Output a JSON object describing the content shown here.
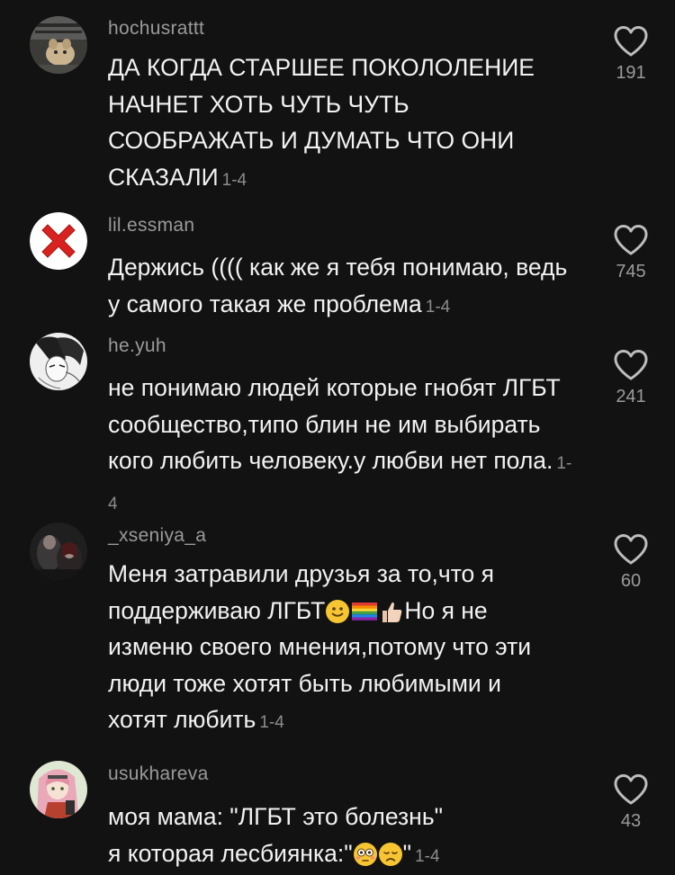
{
  "comments": [
    {
      "username": "hochusrattt",
      "text": "ДА КОГДА СТАРШЕЕ ПОКОЛОЛЕНИЕ НАЧНЕТ ХОТЬ ЧУТЬ ЧУТЬ СООБРАЖАТЬ И ДУМАТЬ ЧТО ОНИ СКАЗАЛИ",
      "meta": "1-4",
      "likes": "191",
      "avatar_icon": "cat-photo-avatar"
    },
    {
      "username": "lil.essman",
      "text": "Держись (((( как же я тебя понимаю, ведь у самого такая же проблема",
      "meta": "1-4",
      "likes": "745",
      "avatar_icon": "red-cross-avatar"
    },
    {
      "username": "he.yuh",
      "text": "не понимаю людей которые гнобят ЛГБТ сообщество,типо блин не им выбирать кого любить человеку.у любви нет пола.",
      "meta": "1-4",
      "likes": "241",
      "avatar_icon": "anime-sketch-avatar"
    },
    {
      "username": "_xseniya_a",
      "text_part1": "Меня затравили друзья за то,что я поддерживаю ЛГБТ",
      "text_part2": "Но я не изменю своего мнения,потому что эти люди тоже хотят быть любимыми и хотят любить",
      "meta": "1-4",
      "likes": "60",
      "emojis": [
        "slightly-smiling-face",
        "rainbow-flag",
        "thumbs-up"
      ],
      "avatar_icon": "dark-photo-avatar"
    },
    {
      "username": "usukhareva",
      "text_line1": "моя мама: \"ЛГБТ это болезнь\"",
      "text_line2_start": "я которая лесбиянка:\"",
      "text_line2_end": "\"",
      "meta": "1-4",
      "likes": "43",
      "emojis": [
        "flushed-face",
        "disappointed-face"
      ],
      "avatar_icon": "anime-girl-avatar"
    }
  ],
  "colors": {
    "background": "#121212",
    "text": "#f2f2f2",
    "secondary": "#9a9a9a",
    "cross_red": "#d9221f"
  }
}
